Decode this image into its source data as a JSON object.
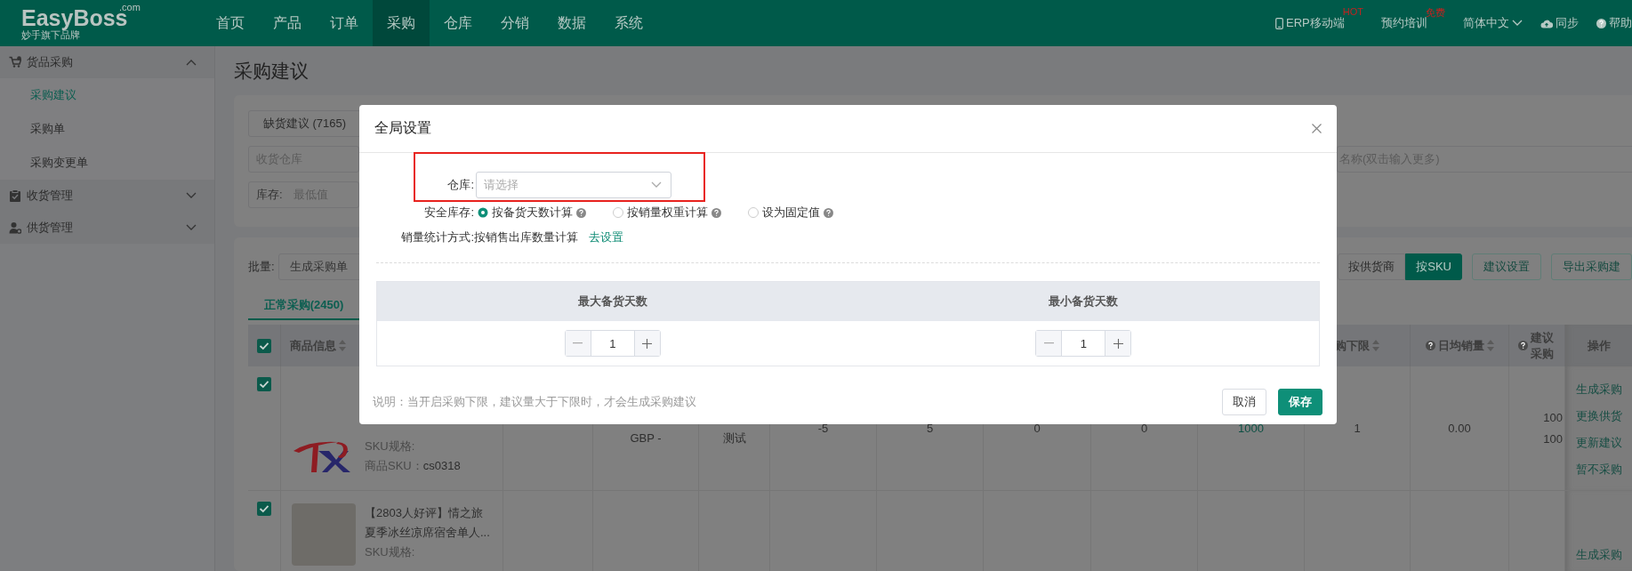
{
  "header": {
    "logo": {
      "brand": "EasyBoss",
      "domain": ".com",
      "tagline": "妙手旗下品牌"
    },
    "nav": [
      {
        "label": "首页",
        "selected": false
      },
      {
        "label": "产品",
        "selected": false
      },
      {
        "label": "订单",
        "selected": false
      },
      {
        "label": "采购",
        "selected": true
      },
      {
        "label": "仓库",
        "selected": false
      },
      {
        "label": "分销",
        "selected": false
      },
      {
        "label": "数据",
        "selected": false
      },
      {
        "label": "系统",
        "selected": false
      }
    ],
    "tools": [
      {
        "kind": "phone",
        "label": "ERP移动端",
        "badge": "HOT"
      },
      {
        "kind": "plain",
        "label": "预约培训",
        "badge": "免费"
      },
      {
        "kind": "dropdown",
        "label": "简体中文"
      },
      {
        "kind": "cloud",
        "label": "同步"
      },
      {
        "kind": "help",
        "label": "帮助"
      }
    ]
  },
  "sidebar": [
    {
      "label": "货品采购",
      "expanded": true,
      "children": [
        {
          "label": "采购建议",
          "selected": true
        },
        {
          "label": "采购单",
          "selected": false
        },
        {
          "label": "采购变更单",
          "selected": false
        }
      ]
    },
    {
      "label": "收货管理",
      "expanded": false
    },
    {
      "label": "供货管理",
      "expanded": false
    }
  ],
  "page_title": "采购建议",
  "filters": {
    "type_button": "缺货建议 (7165)",
    "warehouse_placeholder": "收货仓库",
    "stock_label": "库存:",
    "stock_placeholder": "最低值",
    "search_placeholder": "名称(双击输入更多)"
  },
  "toolbar": {
    "batch_label": "批量:",
    "batch_select": "生成采购单",
    "view_toggle": [
      {
        "label": "按供货商",
        "selected": false
      },
      {
        "label": "按SKU",
        "selected": true
      }
    ],
    "buttons": [
      "建议设置",
      "导出采购建"
    ]
  },
  "tabs": [
    {
      "label": "正常采购(2450)",
      "selected": true
    }
  ],
  "table": {
    "select_all": {
      "checked": true
    },
    "product_header": {
      "label": "商品信息",
      "sortable": true
    },
    "columns": [
      null,
      null,
      null,
      null,
      null,
      null,
      null,
      null,
      {
        "label": "购下限",
        "sortable": true,
        "help": false
      },
      {
        "label": "日均销量",
        "sortable": true,
        "help": true
      },
      {
        "lines": [
          "建议",
          "采购"
        ],
        "sortable": false,
        "help": true
      }
    ],
    "actions_header": "操作",
    "rows": [
      {
        "checked": true,
        "product": {
          "specs": [
            {
              "label": "SKU规格:"
            },
            {
              "label": "商品SKU：",
              "value": "cs0318"
            }
          ]
        },
        "cells": [
          null,
          {
            "kind": "text",
            "text": "GBP -"
          },
          {
            "kind": "text",
            "text": "测试"
          },
          {
            "kind": "text",
            "text": "-5"
          },
          {
            "kind": "text",
            "text": "5"
          },
          {
            "kind": "text",
            "text": "0"
          },
          {
            "kind": "text",
            "text": "0"
          },
          {
            "kind": "link",
            "text": "1000"
          },
          {
            "kind": "text",
            "text": "1"
          },
          {
            "kind": "text",
            "text": "0.00"
          },
          {
            "kind": "lines",
            "lines": [
              "100",
              "100"
            ]
          }
        ],
        "actions": [
          "生成采购",
          "更换供货",
          "更新建议",
          "暂不采购"
        ]
      },
      {
        "checked": true,
        "product": {
          "title": [
            "【2803人好评】情之旅",
            "夏季冰丝凉席宿舍单人..."
          ],
          "specs": [
            {
              "label": "SKU规格:"
            }
          ]
        },
        "cells": [],
        "actions": [
          "生成采购"
        ]
      }
    ]
  },
  "modal": {
    "title": "全局设置",
    "warehouse": {
      "label": "仓库:",
      "placeholder": "请选择",
      "highlighted": true
    },
    "safety_stock": {
      "label": "安全库存:",
      "options": [
        {
          "label": "按备货天数计算",
          "selected": true
        },
        {
          "label": "按销量权重计算",
          "selected": false
        },
        {
          "label": "设为固定值",
          "selected": false
        }
      ]
    },
    "sales_method": {
      "label": "销量统计方式:",
      "value": "按销售出库数量计算",
      "link": "去设置"
    },
    "days_table": {
      "columns": [
        "最大备货天数",
        "最小备货天数"
      ],
      "values": [
        "1",
        "1"
      ]
    },
    "note": "说明：当开启采购下限，建议量大于下限时，才会生成采购建议",
    "buttons": [
      {
        "label": "取消",
        "kind": "default"
      },
      {
        "label": "保存",
        "kind": "primary"
      }
    ]
  }
}
